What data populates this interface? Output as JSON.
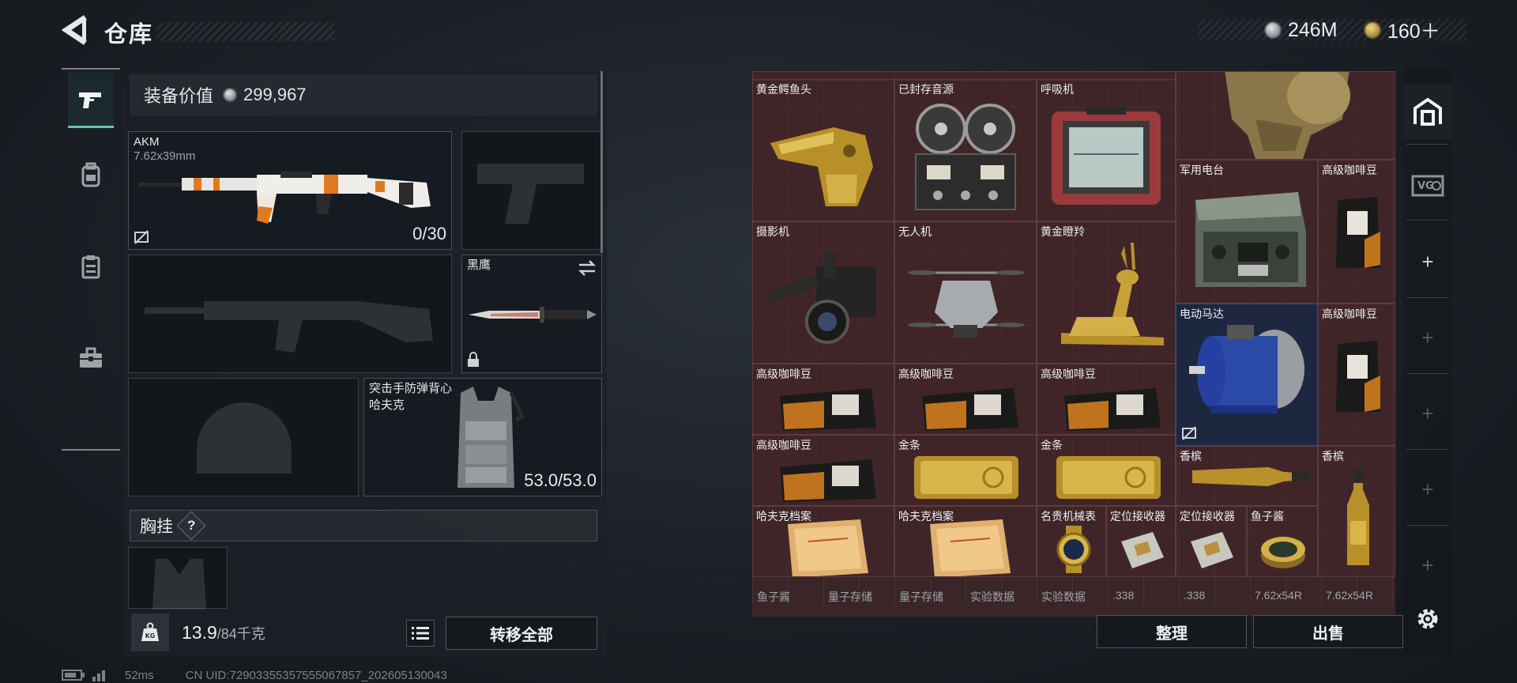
{
  "header": {
    "title": "仓库"
  },
  "currencies": [
    {
      "icon": "silver-coin-icon",
      "value": "246M"
    },
    {
      "icon": "gold-coin-icon",
      "value": "160＋"
    }
  ],
  "left_rail": [
    {
      "icon": "pistol-icon",
      "active": true
    },
    {
      "icon": "backpack-icon",
      "active": false
    },
    {
      "icon": "clipboard-icon",
      "active": false
    },
    {
      "icon": "briefcase-icon",
      "active": false
    }
  ],
  "loadout": {
    "value_label": "装备价值",
    "value": "299,967",
    "primary_weapon": {
      "name": "AKM",
      "ammo": "7.62x39mm",
      "count": "0/30"
    },
    "knife": {
      "name": "黑鹰"
    },
    "armor": {
      "name": "突击手防弹背心",
      "sub": "哈夫克",
      "durability": "53.0/53.0"
    },
    "chest_rig_label": "胸挂",
    "help_label": "?",
    "weight_current": "13.9",
    "weight_max": "/84千克",
    "transfer_all_label": "转移全部"
  },
  "stash": {
    "items": [
      {
        "name": "黄金鳄鱼头",
        "icon": "gold-crocodile-head-icon"
      },
      {
        "name": "已封存音源",
        "icon": "reel-to-reel-recorder-icon"
      },
      {
        "name": "呼吸机",
        "icon": "ventilator-icon"
      },
      {
        "name": "",
        "icon": "gold-bust-icon"
      },
      {
        "name": "军用电台",
        "icon": "military-radio-icon"
      },
      {
        "name": "高级咖啡豆",
        "icon": "coffee-bag-icon"
      },
      {
        "name": "摄影机",
        "icon": "video-camera-icon"
      },
      {
        "name": "无人机",
        "icon": "drone-icon"
      },
      {
        "name": "黄金瞪羚",
        "icon": "gold-gazelle-icon"
      },
      {
        "name": "电动马达",
        "icon": "electric-motor-icon"
      },
      {
        "name": "高级咖啡豆",
        "icon": "coffee-bag-icon"
      },
      {
        "name": "高级咖啡豆",
        "icon": "coffee-pack-icon"
      },
      {
        "name": "高级咖啡豆",
        "icon": "coffee-pack-icon"
      },
      {
        "name": "高级咖啡豆",
        "icon": "coffee-pack-icon"
      },
      {
        "name": "高级咖啡豆",
        "icon": "coffee-pack-icon"
      },
      {
        "name": "金条",
        "icon": "gold-bar-icon"
      },
      {
        "name": "金条",
        "icon": "gold-bar-icon"
      },
      {
        "name": "香槟",
        "icon": "champagne-bottle-icon"
      },
      {
        "name": "香槟",
        "icon": "champagne-bottle-icon"
      },
      {
        "name": "哈夫克档案",
        "icon": "folder-icon"
      },
      {
        "name": "哈夫克档案",
        "icon": "folder-icon"
      },
      {
        "name": "名贵机械表",
        "icon": "gold-watch-icon"
      },
      {
        "name": "定位接收器",
        "icon": "locator-icon"
      },
      {
        "name": "定位接收器",
        "icon": "locator-icon"
      },
      {
        "name": "鱼子酱",
        "icon": "caviar-tin-icon"
      }
    ],
    "bottom_row": [
      "鱼子酱",
      "量子存储",
      "量子存储",
      "实验数据",
      "实验数据",
      ".338",
      ".338",
      "7.62x54R",
      "7.62x54R"
    ],
    "sort_label": "整理",
    "sell_label": "出售"
  },
  "right_rail": [
    {
      "icon": "stash-icon",
      "active": true
    },
    {
      "icon": "vault-icon",
      "active": false
    },
    {
      "icon": "add-icon",
      "active": false
    },
    {
      "icon": "add-icon",
      "active": false
    },
    {
      "icon": "add-icon",
      "active": false
    },
    {
      "icon": "add-icon",
      "active": false
    },
    {
      "icon": "add-icon",
      "active": false
    },
    {
      "icon": "settings-icon",
      "active": false
    }
  ],
  "status": {
    "ping": "52ms",
    "uid": "CN UID:7290335535755506785​7_202605130043"
  }
}
